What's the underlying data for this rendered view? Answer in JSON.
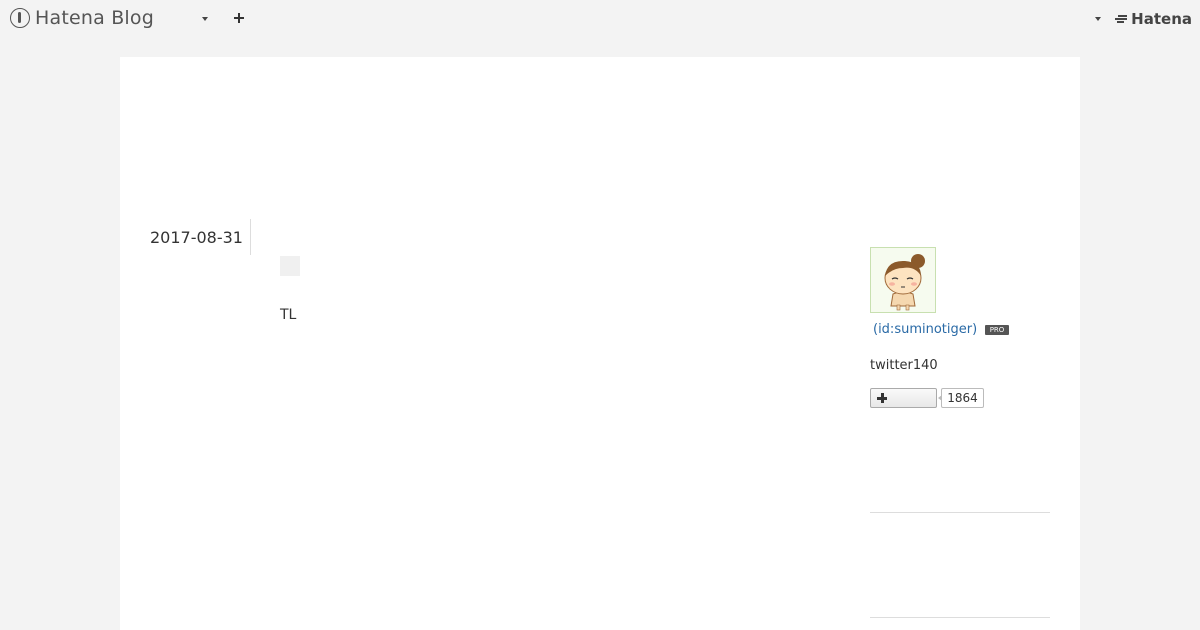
{
  "header": {
    "logo_text": "Hatena Blog",
    "brand_right": "Hatena"
  },
  "entry": {
    "date": "2017-08-31",
    "text": "TL"
  },
  "profile": {
    "user_id": "(id:suminotiger)",
    "badge": "PRO",
    "description": "twitter140",
    "follower_count": "1864"
  },
  "icons": [
    "hatena-blog-logo-icon",
    "dropdown-caret-icon",
    "plus-icon",
    "hatena-logo-icon",
    "avatar-illustration"
  ]
}
